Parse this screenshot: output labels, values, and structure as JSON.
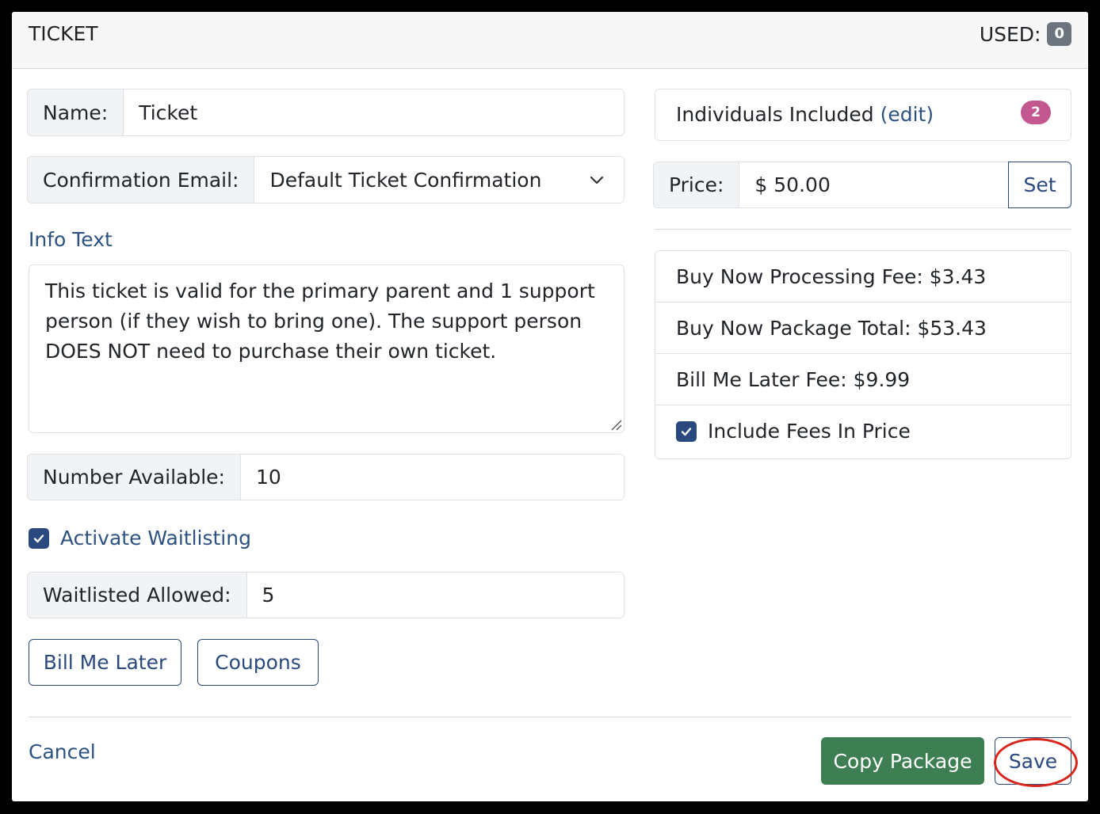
{
  "header": {
    "title": "TICKET",
    "used_label": "USED:",
    "used_count": "0"
  },
  "form": {
    "name_label": "Name:",
    "name_value": "Ticket",
    "confirmation_label": "Confirmation Email:",
    "confirmation_value": "Default Ticket Confirmation",
    "info_label": "Info Text",
    "info_text": "This ticket is valid for the primary parent and 1 support person (if they wish to bring one). The support person DOES NOT need to purchase their own ticket.",
    "number_available_label": "Number Available:",
    "number_available_value": "10",
    "waitlist_checkbox_label": "Activate Waitlisting",
    "waitlisted_allowed_label": "Waitlisted Allowed:",
    "waitlisted_allowed_value": "5",
    "bill_me_later_button": "Bill Me Later",
    "coupons_button": "Coupons"
  },
  "right": {
    "individuals_label": "Individuals Included",
    "individuals_edit": "(edit)",
    "individuals_count": "2",
    "price_label": "Price:",
    "price_value": "$ 50.00",
    "set_button": "Set",
    "fees": [
      "Buy Now Processing Fee: $3.43",
      "Buy Now Package Total: $53.43",
      "Bill Me Later Fee: $9.99"
    ],
    "include_fees_label": "Include Fees In Price"
  },
  "footer": {
    "cancel": "Cancel",
    "copy_package": "Copy Package",
    "save": "Save"
  },
  "colors": {
    "accent": "#2a4a7f",
    "green": "#3d7f53",
    "badge_pink": "#c2588f",
    "badge_gray": "#6c757d",
    "highlight": "#d9261c"
  }
}
